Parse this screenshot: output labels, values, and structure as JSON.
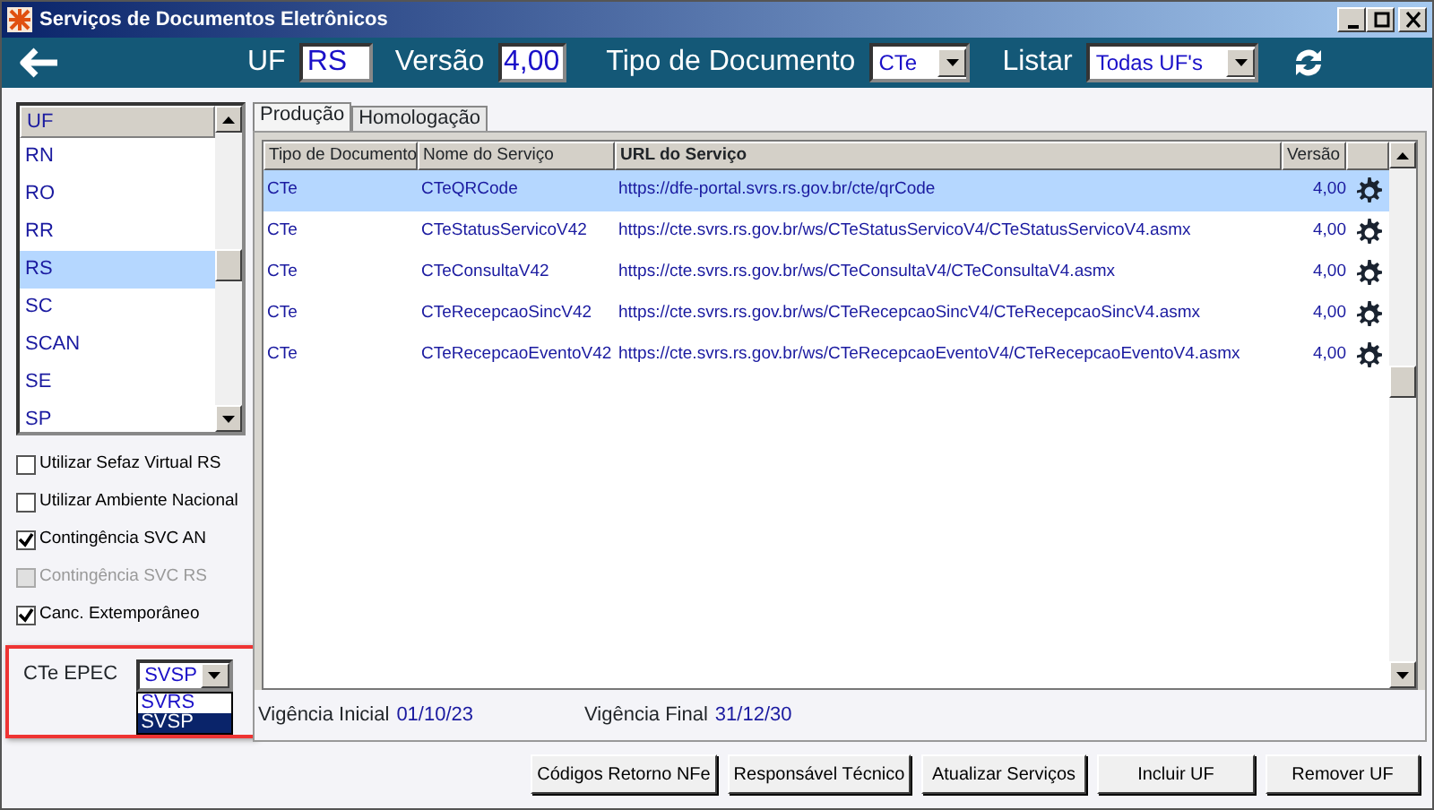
{
  "window": {
    "title": "Serviços de Documentos Eletrônicos"
  },
  "toolbar": {
    "uf_label": "UF",
    "uf_value": "RS",
    "versao_label": "Versão",
    "versao_value": "4,00",
    "tipo_label": "Tipo de Documento",
    "tipo_value": "CTe",
    "listar_label": "Listar",
    "listar_value": "Todas UF's"
  },
  "uf_list": {
    "header": "UF",
    "items": [
      {
        "label": "RN",
        "selected": false
      },
      {
        "label": "RO",
        "selected": false
      },
      {
        "label": "RR",
        "selected": false
      },
      {
        "label": "RS",
        "selected": true
      },
      {
        "label": "SC",
        "selected": false
      },
      {
        "label": "SCAN",
        "selected": false
      },
      {
        "label": "SE",
        "selected": false
      },
      {
        "label": "SP",
        "selected": false
      }
    ]
  },
  "options": [
    {
      "label": "Utilizar Sefaz Virtual RS",
      "checked": false,
      "disabled": false
    },
    {
      "label": "Utilizar Ambiente Nacional",
      "checked": false,
      "disabled": false
    },
    {
      "label": "Contingência SVC AN",
      "checked": true,
      "disabled": false
    },
    {
      "label": "Contingência SVC RS",
      "checked": false,
      "disabled": true
    },
    {
      "label": "Canc. Extemporâneo",
      "checked": true,
      "disabled": false
    }
  ],
  "epec": {
    "label": "CTe EPEC",
    "value": "SVSP",
    "expanded": true,
    "options": [
      {
        "label": "SVRS",
        "selected": false
      },
      {
        "label": "SVSP",
        "selected": true
      }
    ]
  },
  "tabs": [
    {
      "label": "Produção",
      "selected": true
    },
    {
      "label": "Homologação",
      "selected": false
    }
  ],
  "table": {
    "columns": [
      "Tipo de Documento",
      "Nome do Serviço",
      "URL do Serviço",
      "Versão"
    ],
    "rows": [
      {
        "cells": [
          "CTe",
          "CTeQRCode",
          "https://dfe-portal.svrs.rs.gov.br/cte/qrCode",
          "4,00"
        ],
        "selected": true
      },
      {
        "cells": [
          "CTe",
          "CTeStatusServicoV42",
          "https://cte.svrs.rs.gov.br/ws/CTeStatusServicoV4/CTeStatusServicoV4.asmx",
          "4,00"
        ],
        "selected": false
      },
      {
        "cells": [
          "CTe",
          "CTeConsultaV42",
          "https://cte.svrs.rs.gov.br/ws/CTeConsultaV4/CTeConsultaV4.asmx",
          "4,00"
        ],
        "selected": false
      },
      {
        "cells": [
          "CTe",
          "CTeRecepcaoSincV42",
          "https://cte.svrs.rs.gov.br/ws/CTeRecepcaoSincV4/CTeRecepcaoSincV4.asmx",
          "4,00"
        ],
        "selected": false
      },
      {
        "cells": [
          "CTe",
          "CTeRecepcaoEventoV42",
          "https://cte.svrs.rs.gov.br/ws/CTeRecepcaoEventoV4/CTeRecepcaoEventoV4.asmx",
          "4,00"
        ],
        "selected": false
      }
    ]
  },
  "footer": {
    "vigencia_inicial_label": "Vigência Inicial",
    "vigencia_inicial": "01/10/23",
    "vigencia_final_label": "Vigência Final",
    "vigencia_final": "31/12/30"
  },
  "buttons": [
    "Códigos Retorno NFe",
    "Responsável Técnico",
    "Atualizar Serviços",
    "Incluir UF",
    "Remover UF"
  ]
}
